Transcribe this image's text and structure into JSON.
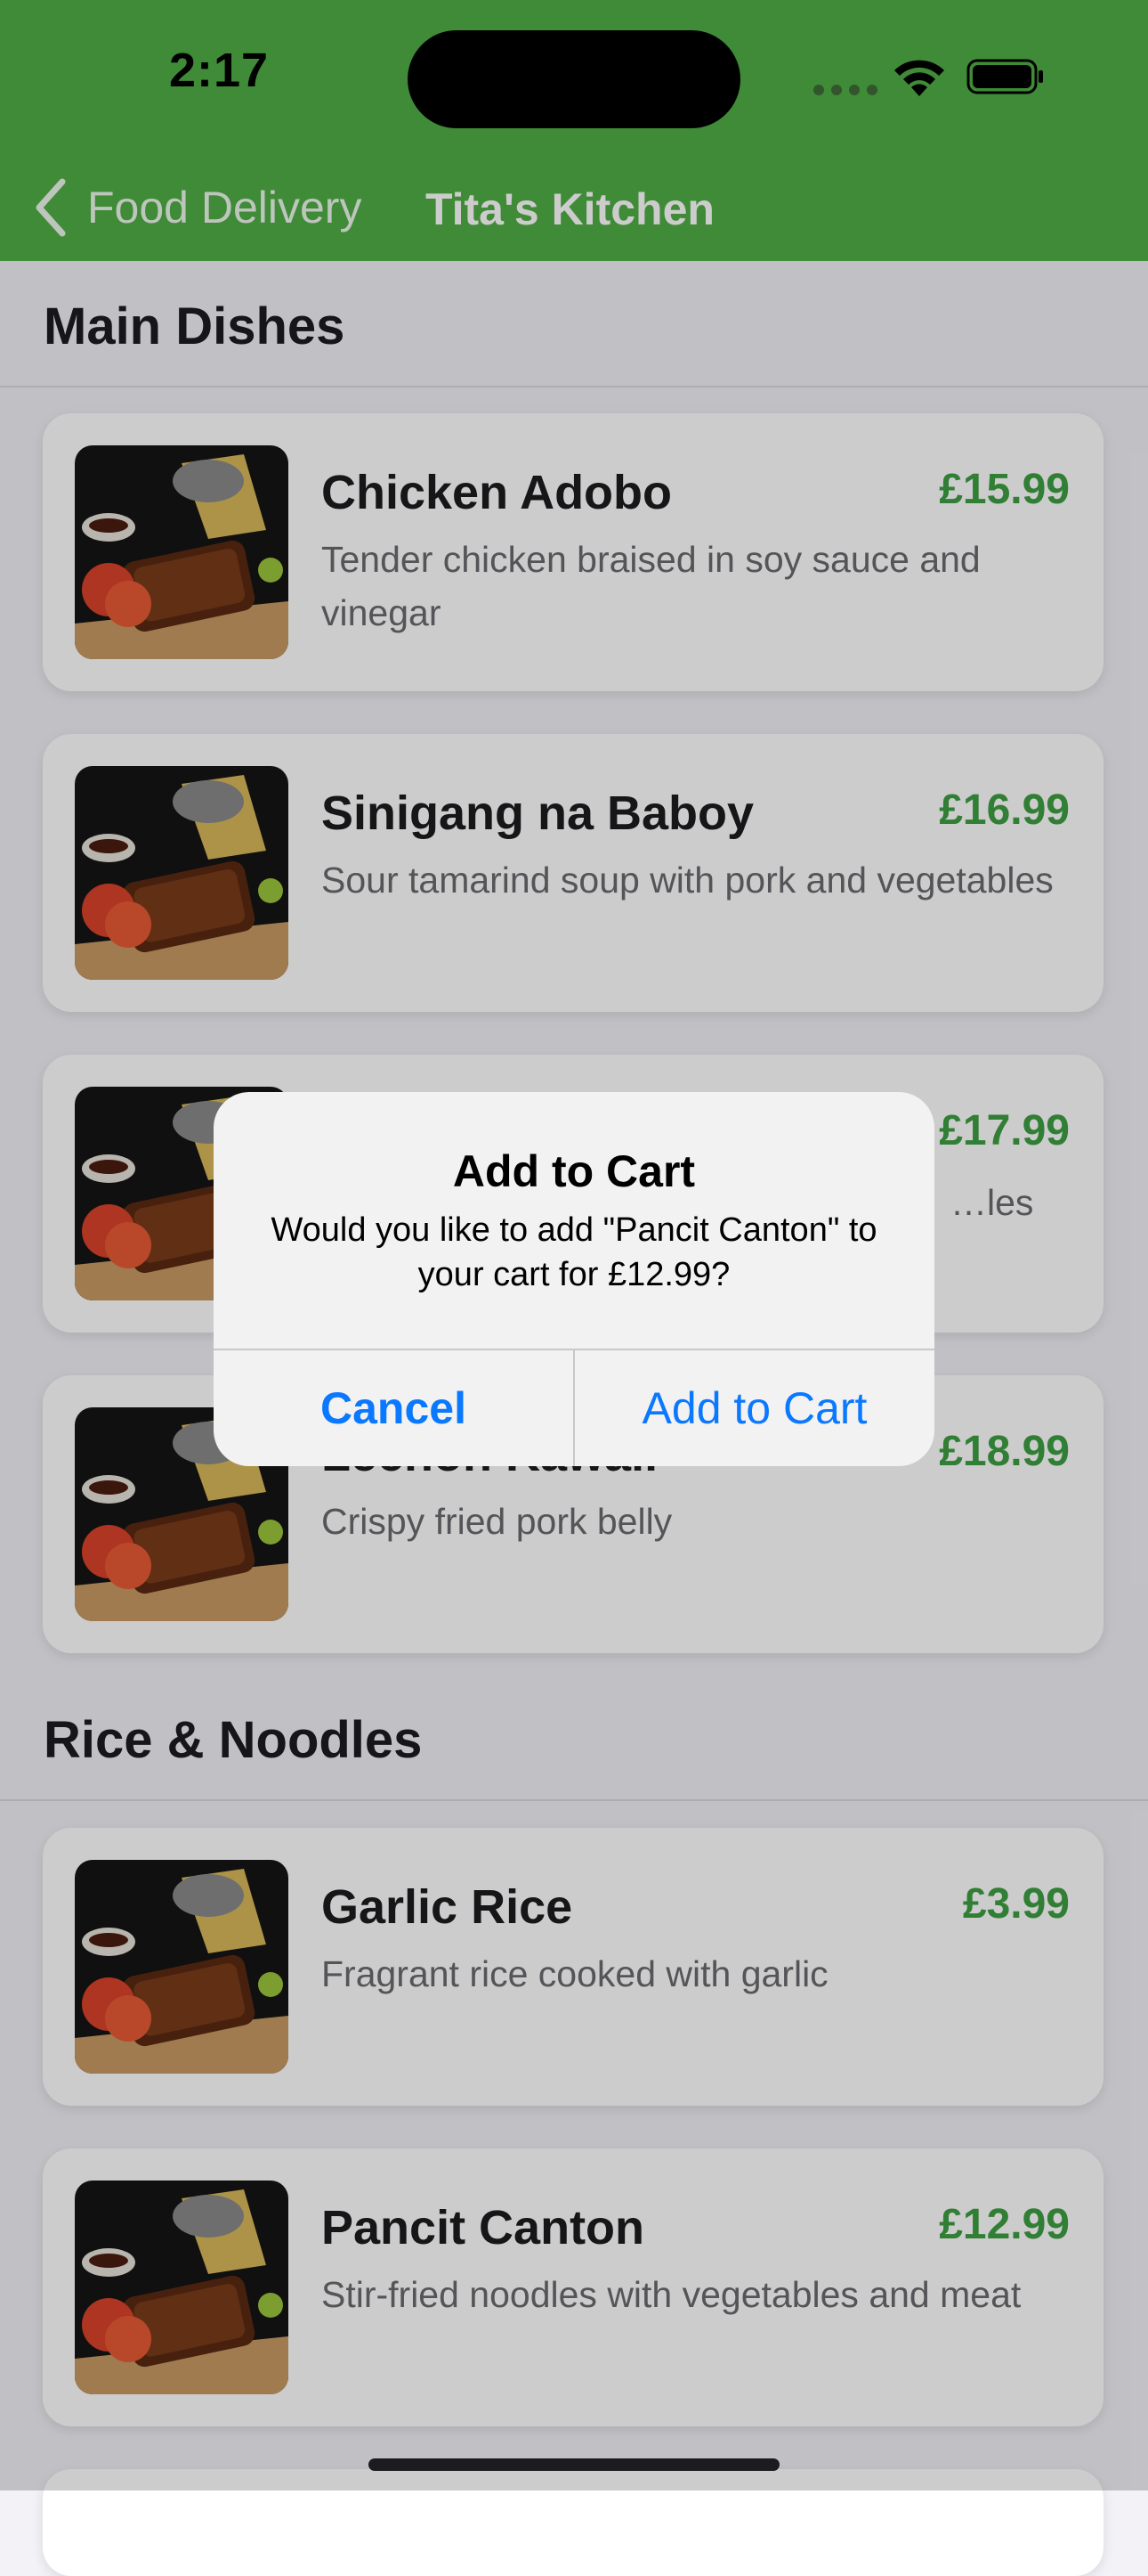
{
  "status_bar": {
    "time": "2:17"
  },
  "nav": {
    "back_label": "Food Delivery",
    "title": "Tita's Kitchen"
  },
  "sections": [
    {
      "title": "Main Dishes",
      "items": [
        {
          "name": "Chicken Adobo",
          "price": "£15.99",
          "description": "Tender chicken braised in soy sauce and vinegar"
        },
        {
          "name": "Sinigang na Baboy",
          "price": "£16.99",
          "description": "Sour tamarind soup with pork and vegetables"
        },
        {
          "name": "",
          "price": "£17.99",
          "description": "…les"
        },
        {
          "name": "Lechon Kawali",
          "price": "£18.99",
          "description": "Crispy fried pork belly"
        }
      ]
    },
    {
      "title": "Rice & Noodles",
      "items": [
        {
          "name": "Garlic Rice",
          "price": "£3.99",
          "description": "Fragrant rice cooked with garlic"
        },
        {
          "name": "Pancit Canton",
          "price": "£12.99",
          "description": "Stir-fried noodles with vegetables and meat"
        }
      ]
    }
  ],
  "alert": {
    "title": "Add to Cart",
    "message": "Would you like to add \"Pancit Canton\" to your cart for £12.99?",
    "cancel_label": "Cancel",
    "confirm_label": "Add to Cart"
  },
  "colors": {
    "header": "#4fae45",
    "price": "#3e9e43",
    "accent": "#0a78ff"
  }
}
